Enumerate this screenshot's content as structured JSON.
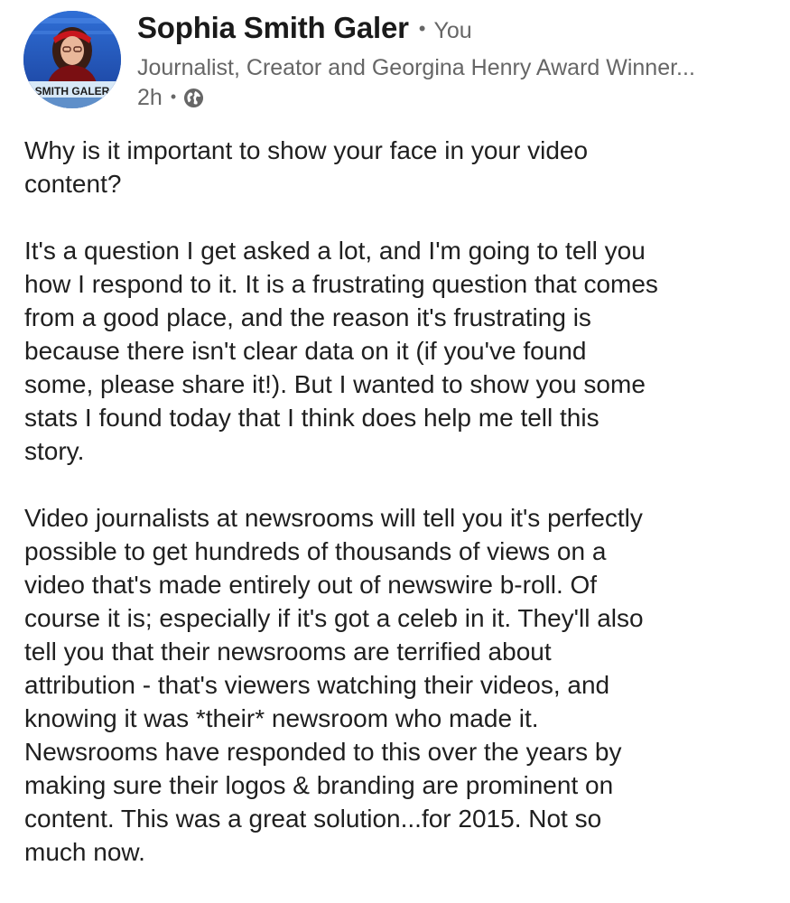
{
  "post": {
    "author": {
      "name": "Sophia Smith Galer",
      "relationship": "You",
      "headline": "Journalist, Creator and Georgina Henry Award Winner...",
      "avatar_caption": "SMITH GALER"
    },
    "time_ago": "2h",
    "visibility_icon": "globe-icon",
    "body": {
      "paragraphs": [
        "Why is it important to show your face in your video\ncontent?",
        "It's a question I get asked a lot, and I'm going to tell you\nhow I respond to it. It is a frustrating question that comes\nfrom a good place, and the reason it's frustrating is\nbecause there isn't clear data on it (if you've found\nsome, please share it!). But I wanted to show you some\nstats I found today that I think does help me tell this\nstory.",
        "Video journalists at newsrooms will tell you it's perfectly\npossible to get hundreds of thousands of views on a\nvideo that's made entirely out of newswire b-roll. Of\ncourse it is; especially if it's got a celeb in it. They'll also\ntell you that their newsrooms are terrified about\nattribution - that's viewers watching their videos, and\nknowing it was *their* newsroom who made it.\nNewsrooms have responded to this over the years by\nmaking sure their logos & branding are prominent on\ncontent. This was a great solution...for 2015. Not so\nmuch now."
      ]
    }
  }
}
